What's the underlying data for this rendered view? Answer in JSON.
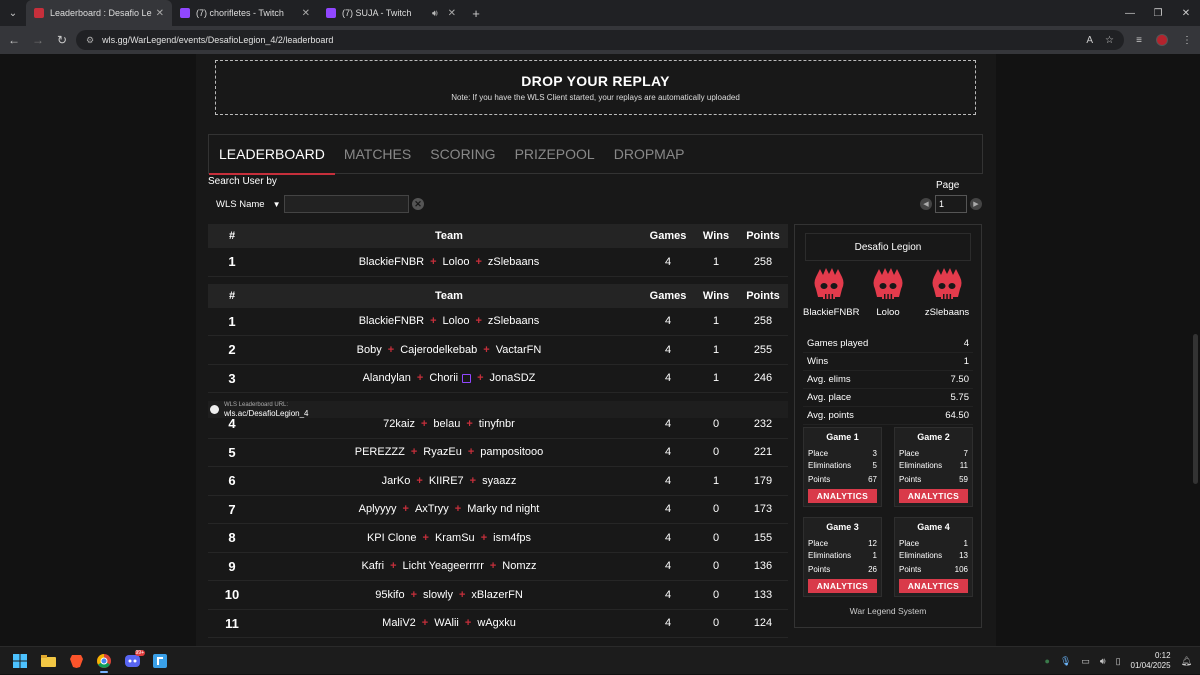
{
  "browser": {
    "tabs": [
      {
        "label": "Leaderboard : Desafio Legion -",
        "active": true,
        "color": "#c62f3b"
      },
      {
        "label": "(7) chorifletes - Twitch",
        "active": false,
        "color": "#9147ff"
      },
      {
        "label": "(7) SUJA - Twitch",
        "active": false,
        "color": "#9147ff"
      }
    ],
    "url": "wls.gg/WarLegend/events/DesafioLegion_4/2/leaderboard"
  },
  "drop": {
    "title": "DROP YOUR REPLAY",
    "note": "Note: If you have the WLS Client started, your replays are automatically uploaded"
  },
  "nav": {
    "tabs": [
      "LEADERBOARD",
      "MATCHES",
      "SCORING",
      "PRIZEPOOL",
      "DROPMAP"
    ],
    "active": "LEADERBOARD"
  },
  "search": {
    "label": "Search User by",
    "field": "WLS Name",
    "value": ""
  },
  "pager": {
    "label": "Page",
    "value": "1"
  },
  "table": {
    "headers": {
      "rank": "#",
      "team": "Team",
      "games": "Games",
      "wins": "Wins",
      "points": "Points"
    },
    "highlight": {
      "rank": "1",
      "players": [
        "BlackieFNBR",
        "Loloo",
        "zSlebaans"
      ],
      "games": "4",
      "wins": "1",
      "points": "258"
    },
    "rows": [
      {
        "rank": "1",
        "players": [
          "BlackieFNBR",
          "Loloo",
          "zSlebaans"
        ],
        "games": "4",
        "wins": "1",
        "points": "258"
      },
      {
        "rank": "2",
        "players": [
          "Boby",
          "Cajerodelkebab",
          "VactarFN"
        ],
        "games": "4",
        "wins": "1",
        "points": "255"
      },
      {
        "rank": "3",
        "players": [
          "Alandylan",
          "Chorii",
          "JonaSDZ"
        ],
        "games": "4",
        "wins": "1",
        "points": "246"
      },
      {
        "rank": "4",
        "players": [
          "72kaiz",
          "belau",
          "tinyfnbr"
        ],
        "games": "4",
        "wins": "0",
        "points": "232"
      },
      {
        "rank": "5",
        "players": [
          "PEREZZZ",
          "RyazEu",
          "pampositooo"
        ],
        "games": "4",
        "wins": "0",
        "points": "221"
      },
      {
        "rank": "6",
        "players": [
          "JarKo",
          "KIIRE7",
          "syaazz"
        ],
        "games": "4",
        "wins": "1",
        "points": "179"
      },
      {
        "rank": "7",
        "players": [
          "Aplyyyy",
          "AxTryy",
          "Marky nd night"
        ],
        "games": "4",
        "wins": "0",
        "points": "173"
      },
      {
        "rank": "8",
        "players": [
          "KPI Clone",
          "KramSu",
          "ism4fps"
        ],
        "games": "4",
        "wins": "0",
        "points": "155"
      },
      {
        "rank": "9",
        "players": [
          "Kafri",
          "Licht Yeageerrrrr",
          "Nomzz"
        ],
        "games": "4",
        "wins": "0",
        "points": "136"
      },
      {
        "rank": "10",
        "players": [
          "95kifo",
          "slowly",
          "xBlazerFN"
        ],
        "games": "4",
        "wins": "0",
        "points": "133"
      },
      {
        "rank": "11",
        "players": [
          "MaliV2",
          "WAlii",
          "wAgxku"
        ],
        "games": "4",
        "wins": "0",
        "points": "124"
      }
    ],
    "overlay": {
      "small": "WLS Leaderboard URL:",
      "url": "wls.ac/DesafioLegion_4"
    }
  },
  "side": {
    "title": "Desafio Legion",
    "players": [
      "BlackieFNBR",
      "Loloo",
      "zSlebaans"
    ],
    "stats": [
      {
        "label": "Games played",
        "value": "4"
      },
      {
        "label": "Wins",
        "value": "1"
      },
      {
        "label": "Avg. elims",
        "value": "7.50"
      },
      {
        "label": "Avg. place",
        "value": "5.75"
      },
      {
        "label": "Avg. points",
        "value": "64.50"
      }
    ],
    "games": [
      {
        "title": "Game 1",
        "place": "3",
        "elims": "5",
        "points": "67"
      },
      {
        "title": "Game 2",
        "place": "7",
        "elims": "11",
        "points": "59"
      },
      {
        "title": "Game 3",
        "place": "12",
        "elims": "1",
        "points": "26"
      },
      {
        "title": "Game 4",
        "place": "1",
        "elims": "13",
        "points": "106"
      }
    ],
    "labels": {
      "place": "Place",
      "elims": "Eliminations",
      "points": "Points",
      "analytics": "ANALYTICS"
    },
    "footer": "War Legend System"
  },
  "taskbar": {
    "time": "0:12",
    "date": "01/04/2025",
    "discord_badge": "99+"
  }
}
